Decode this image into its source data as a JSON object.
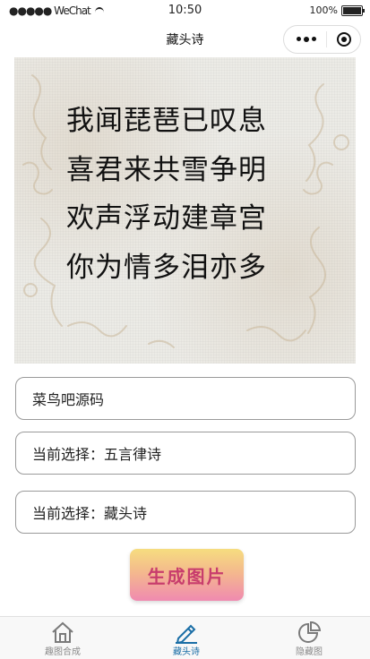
{
  "status_bar": {
    "carrier": "●●●●● WeChat",
    "time": "10:50",
    "battery": "100%"
  },
  "nav": {
    "title": "藏头诗"
  },
  "poem": {
    "lines": [
      "我闻琵琶已叹息",
      "喜君来共雪争明",
      "欢声浮动建章宫",
      "你为情多泪亦多"
    ]
  },
  "fields": {
    "name": "菜鸟吧源码",
    "type": "当前选择：五言律诗",
    "mode": "当前选择：藏头诗"
  },
  "generate_button": {
    "label": "生成图片"
  },
  "tab_bar": {
    "items": [
      {
        "label": "趣图合成",
        "icon": "house-icon",
        "active": false
      },
      {
        "label": "藏头诗",
        "icon": "pen-icon",
        "active": true
      },
      {
        "label": "隐藏图",
        "icon": "pie-chart-icon",
        "active": false
      }
    ]
  }
}
